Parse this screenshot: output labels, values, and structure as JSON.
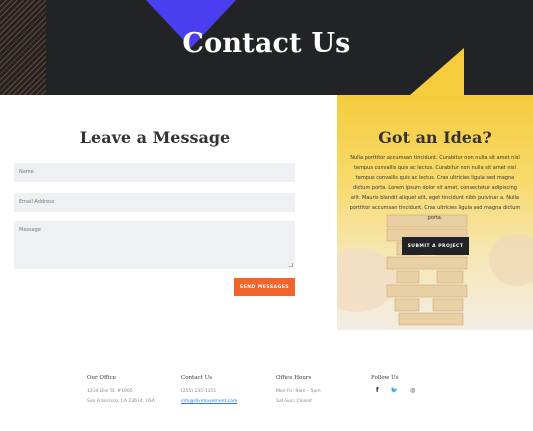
{
  "hero": {
    "title": "Contact Us"
  },
  "form": {
    "title": "Leave a Message",
    "name_placeholder": "Name",
    "email_placeholder": "Email Address",
    "message_placeholder": "Message",
    "send_label": "SEND MESSAGES"
  },
  "idea": {
    "title": "Got an Idea?",
    "text": "Nulla porttitor accumsan tincidunt. Curabitur non nulla sit amet nisl tempus convallis quis ac lectus. Curabitur non nulla sit amet nisl tempus convallis quis ac lectus. Cras ultricies ligula sed magna dictum porta. Lorem ipsum dolor sit amet, consectetur adipiscing elit. Mauris blandit aliquet elit, eget tincidunt nibh pulvinar a. Nulla porttitor accumsan tincidunt. Cras ultricies ligula sed magna dictum porta.",
    "submit_label": "SUBMIT A PROJECT"
  },
  "footer": {
    "office": {
      "heading": "Our Office",
      "line1": "1234 Divi St. #1000",
      "line2": "San Francisco, CA 23614, USA"
    },
    "contact": {
      "heading": "Contact Us",
      "phone": "(255) 235-1351",
      "email": "info@divimovement.com"
    },
    "hours": {
      "heading": "Office Hours",
      "line1": "Mon-Fri: 9am – 5pm",
      "line2": "Sat-Sun: Closed"
    },
    "social": {
      "heading": "Follow Us",
      "icons": [
        "facebook-icon",
        "twitter-icon",
        "instagram-icon"
      ]
    }
  },
  "colors": {
    "dark": "#222326",
    "accent_blue": "#4a3ff0",
    "accent_orange": "#f2652a",
    "accent_yellow": "#f5cc3c",
    "link": "#2d7bd4"
  }
}
